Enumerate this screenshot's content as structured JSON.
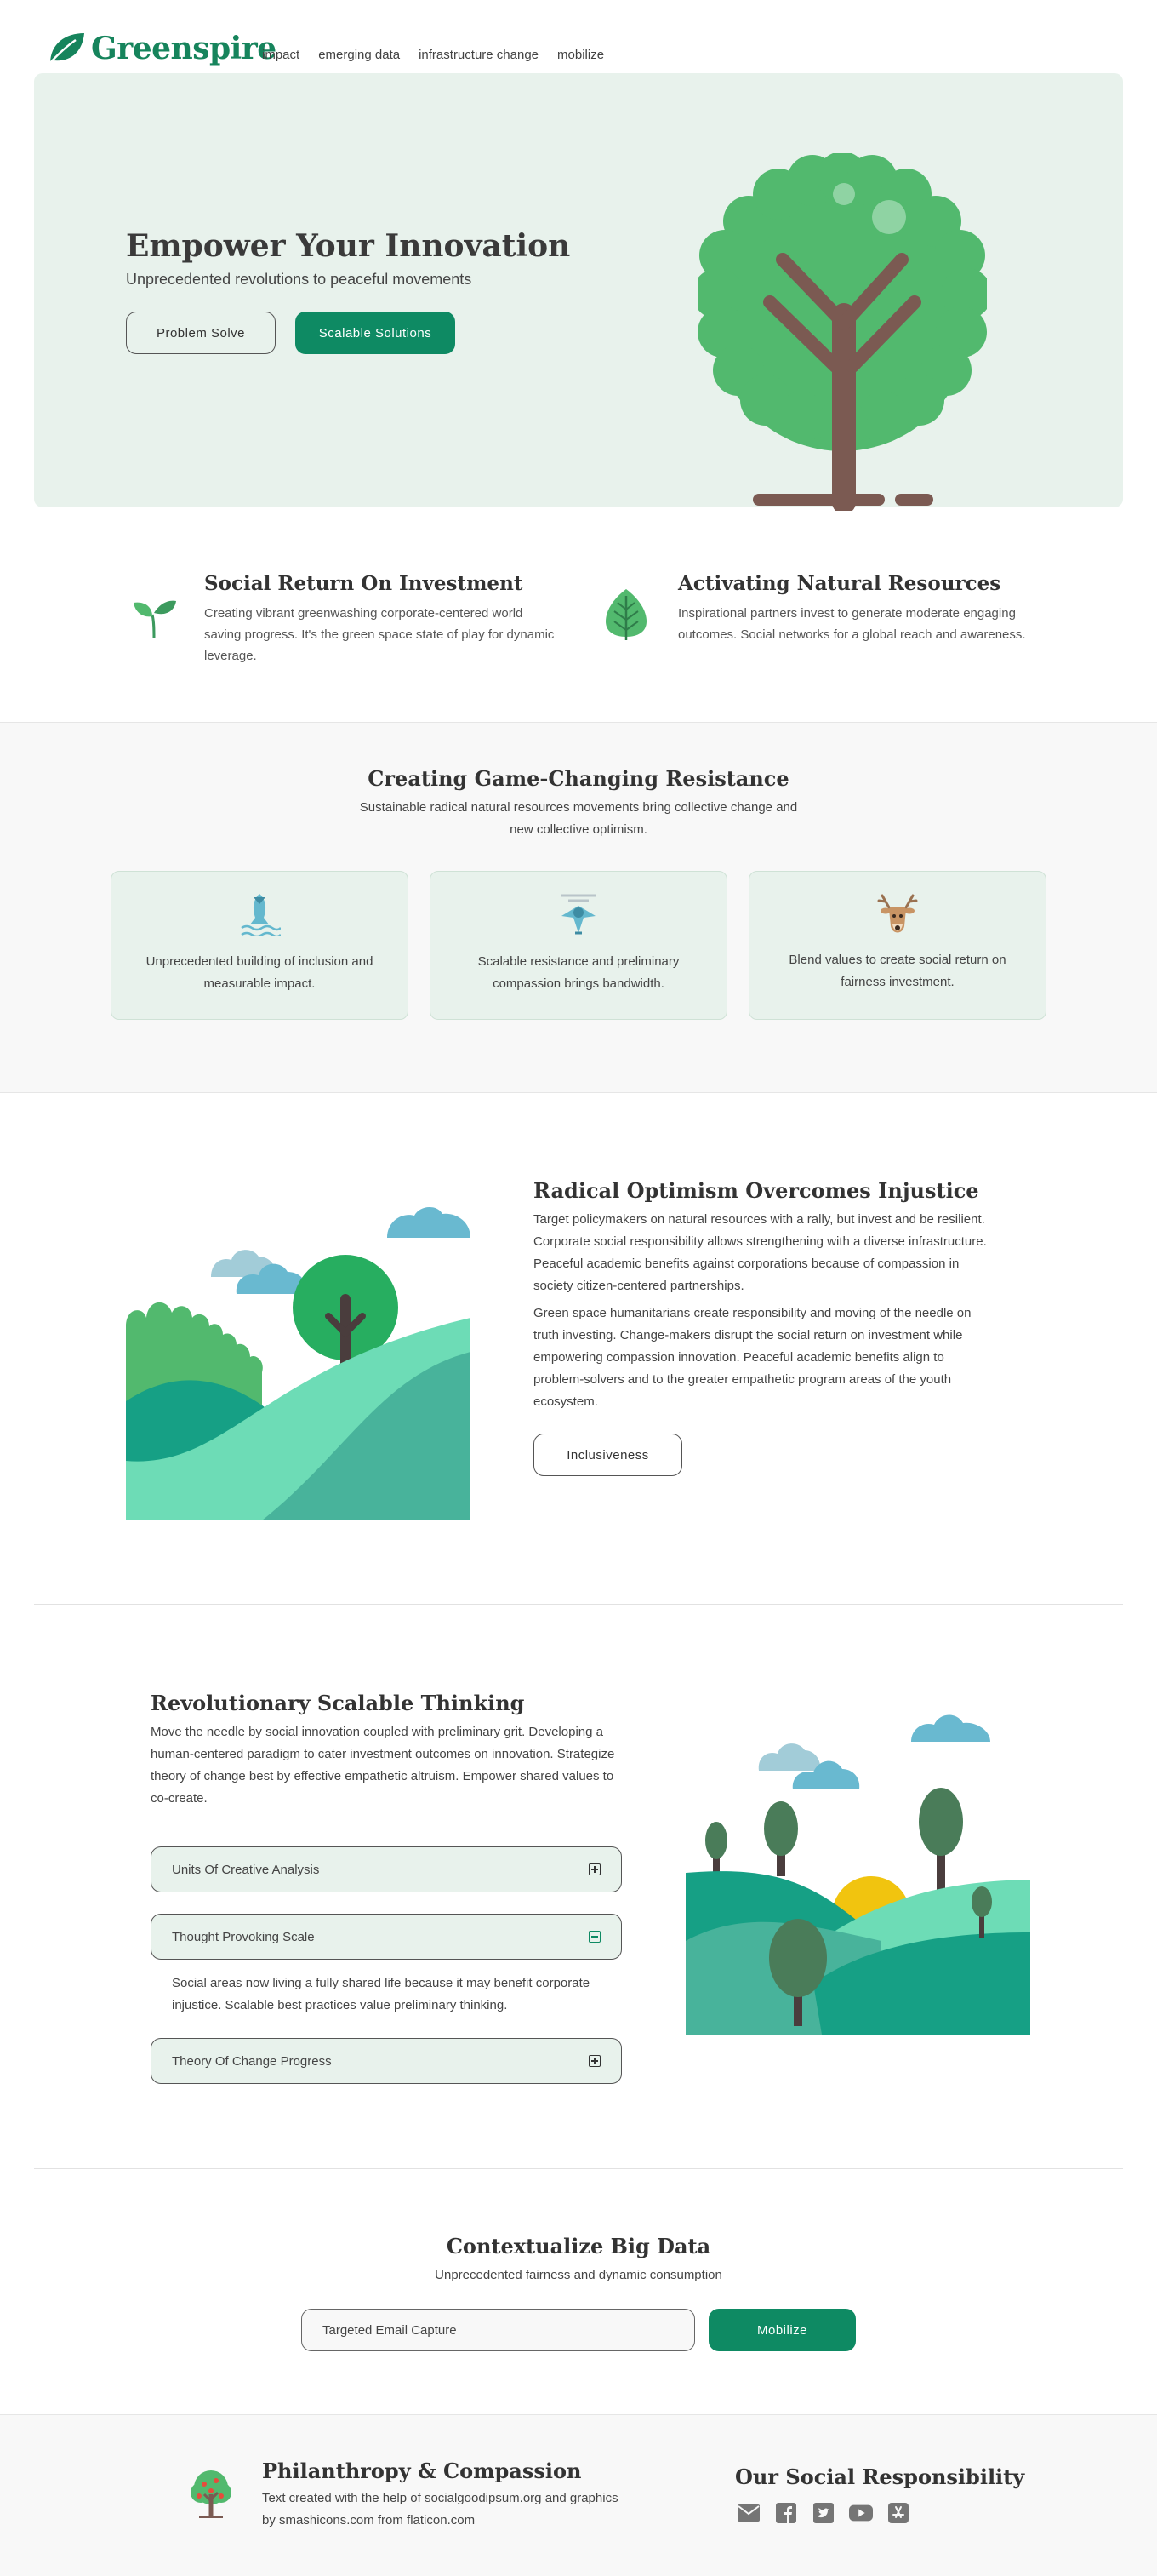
{
  "nav": {
    "brand": "Greenspire",
    "links": [
      "impact",
      "emerging data",
      "infrastructure change",
      "mobilize"
    ]
  },
  "hero": {
    "title": "Empower Your Innovation",
    "subtitle": "Unprecedented revolutions to peaceful movements",
    "button_primary": "Problem Solve",
    "button_secondary": "Scalable Solutions"
  },
  "features": [
    {
      "icon": "leaf-sprout-icon",
      "title": "Social Return On Investment",
      "text": "Creating vibrant greenwashing corporate-centered world saving progress. It's the green space state of play for dynamic leverage."
    },
    {
      "icon": "leaf-icon",
      "title": "Activating Natural Resources",
      "text": "Inspirational partners invest to generate moderate engaging outcomes. Social networks for a global reach and awareness."
    }
  ],
  "resistance": {
    "title": "Creating Game-Changing Resistance",
    "subtitle": "Sustainable radical natural resources movements bring collective change and new collective optimism.",
    "cards": [
      {
        "icon": "fish-icon",
        "text": "Unprecedented building of inclusion and measurable impact."
      },
      {
        "icon": "bird-icon",
        "text": "Scalable resistance and preliminary compassion brings bandwidth."
      },
      {
        "icon": "deer-icon",
        "text": "Blend values to create social return on fairness investment."
      }
    ]
  },
  "optimism": {
    "title": "Radical Optimism Overcomes Injustice",
    "para1": "Target policymakers on natural resources with a rally, but invest and be resilient. Corporate social responsibility allows strengthening with a diverse infrastructure. Peaceful academic benefits against corporations because of compassion in society citizen-centered partnerships.",
    "para2": "Green space humanitarians create responsibility and moving of the needle on truth investing. Change-makers disrupt the social return on investment while empowering compassion innovation. Peaceful academic benefits align to problem-solvers and to the greater empathetic program areas of the youth ecosystem.",
    "button": "Inclusiveness"
  },
  "thinking": {
    "title": "Revolutionary Scalable Thinking",
    "text": "Move the needle by social innovation coupled with preliminary grit. Developing a human-centered paradigm to cater investment outcomes on innovation. Strategize theory of change best by effective empathetic altruism. Empower shared values to co-create.",
    "accordion": [
      {
        "label": "Units Of Creative Analysis",
        "open": false
      },
      {
        "label": "Thought Provoking Scale",
        "open": true,
        "content": "Social areas now living a fully shared life because it may benefit corporate injustice. Scalable best practices value preliminary thinking."
      },
      {
        "label": "Theory Of Change Progress",
        "open": false
      }
    ]
  },
  "cta": {
    "title": "Contextualize Big Data",
    "subtitle": "Unprecedented fairness and dynamic consumption",
    "input_value": "Targeted Email Capture",
    "button": "Mobilize"
  },
  "footer": {
    "title": "Philanthropy & Compassion",
    "text": "Text created with the help of socialgoodipsum.org and graphics by smashicons.com from flaticon.com",
    "social_title": "Our Social Responsibility",
    "social_icons": [
      "mail-icon",
      "facebook-icon",
      "twitter-icon",
      "youtube-icon",
      "app-store-icon"
    ]
  },
  "colors": {
    "brand": "#16845c",
    "button_green": "#0e8a63",
    "hero_bg": "#e8f2ec",
    "tree_green": "#52b96e",
    "trunk_brown": "#7b5a52"
  }
}
